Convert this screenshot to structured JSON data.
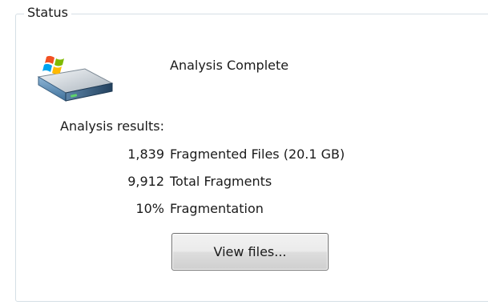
{
  "status_group": {
    "title": "Status",
    "icon": "hard-drive-icon",
    "status_text": "Analysis Complete",
    "results_label": "Analysis results:",
    "results": [
      {
        "value": "1,839",
        "description": "Fragmented Files (20.1 GB)"
      },
      {
        "value": "9,912",
        "description": "Total Fragments"
      },
      {
        "value": "10%",
        "description": "Fragmentation"
      }
    ],
    "view_button_label": "View files..."
  },
  "colors": {
    "groupbox_border": "#d5dfe5",
    "button_border": "#707070",
    "text": "#1a1a1a"
  }
}
